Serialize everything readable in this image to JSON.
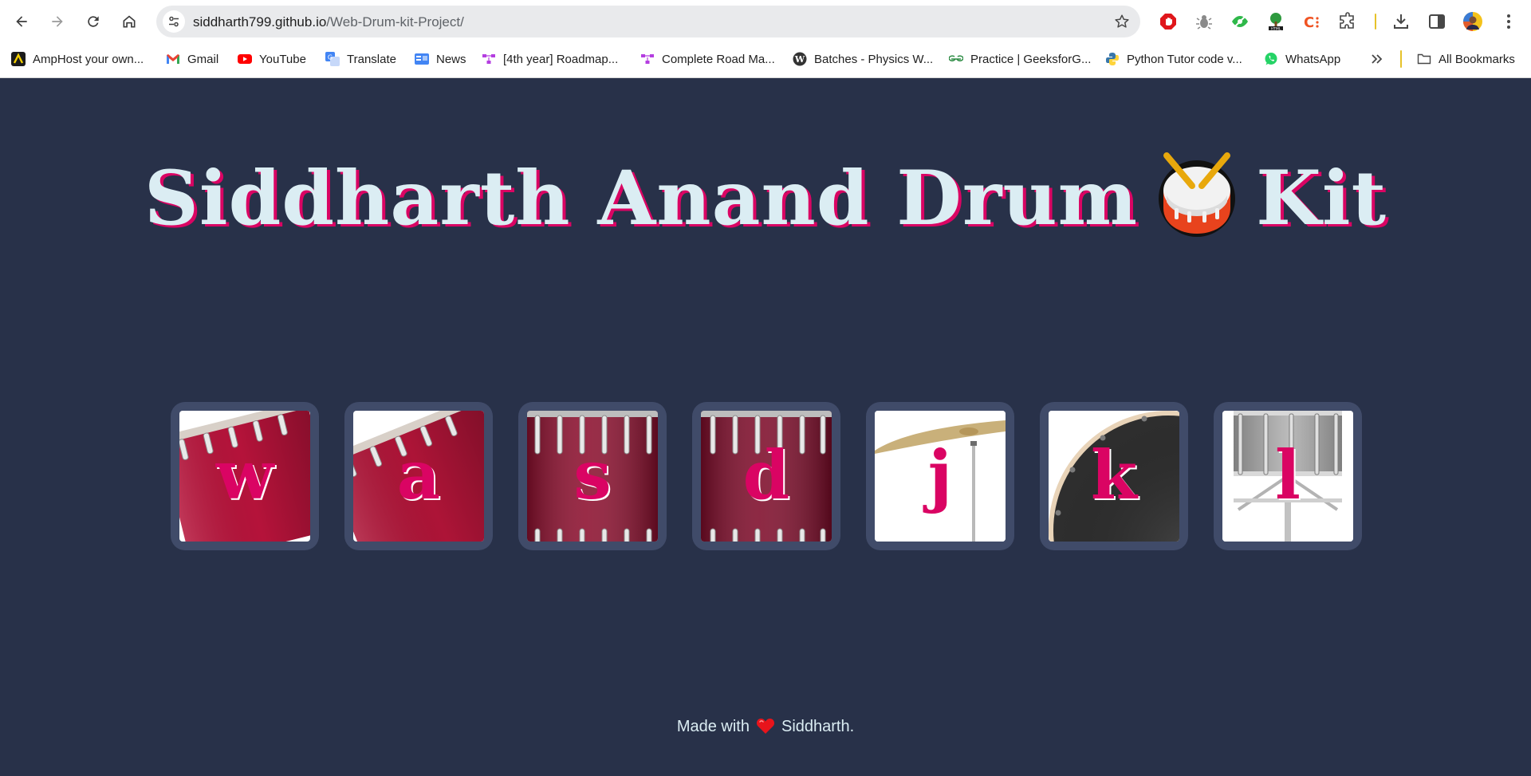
{
  "browser": {
    "url_host": "siddharth799.github.io",
    "url_path": "/Web-Drum-kit-Project/",
    "bookmarks": [
      {
        "label": "AmpHost your own...",
        "icon": "amphost-icon"
      },
      {
        "label": "Gmail",
        "icon": "gmail-icon"
      },
      {
        "label": "YouTube",
        "icon": "youtube-icon"
      },
      {
        "label": "Translate",
        "icon": "translate-icon"
      },
      {
        "label": "News",
        "icon": "news-icon"
      },
      {
        "label": "[4th year] Roadmap...",
        "icon": "roadmap-icon"
      },
      {
        "label": "Complete Road Ma...",
        "icon": "roadmap-icon"
      },
      {
        "label": "Batches - Physics W...",
        "icon": "wordpress-icon"
      },
      {
        "label": "Practice | GeeksforG...",
        "icon": "geeksforgeeks-icon"
      },
      {
        "label": "Python Tutor code v...",
        "icon": "python-icon"
      },
      {
        "label": "WhatsApp",
        "icon": "whatsapp-icon"
      }
    ],
    "all_bookmarks_label": "All Bookmarks"
  },
  "page": {
    "title_before": "Siddharth Anand Drum",
    "title_after": "Kit",
    "drums": [
      {
        "key": "w",
        "image": "tom-drum-1"
      },
      {
        "key": "a",
        "image": "tom-drum-2"
      },
      {
        "key": "s",
        "image": "tom-drum-3"
      },
      {
        "key": "d",
        "image": "tom-drum-4"
      },
      {
        "key": "j",
        "image": "crash-cymbal"
      },
      {
        "key": "k",
        "image": "kick-bass-drum"
      },
      {
        "key": "l",
        "image": "snare-drum"
      }
    ],
    "footer_before": "Made with",
    "footer_after": "Siddharth."
  },
  "colors": {
    "background": "#283149",
    "pad": "#404b69",
    "accent": "#da0463",
    "text": "#dbedf3"
  }
}
